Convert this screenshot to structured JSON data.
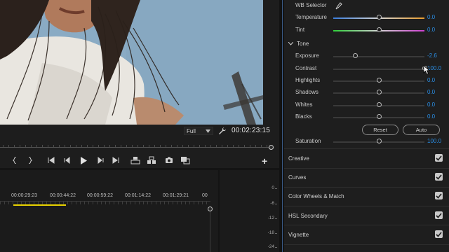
{
  "monitor": {
    "zoom": "Full",
    "timecode": "00:02:23:15"
  },
  "timeline": {
    "ruler": [
      "00:00:29:23",
      "00:00:44:22",
      "00:00:59:22",
      "00:01:14:22",
      "00:01:29:21",
      "00"
    ],
    "meter": [
      "0",
      "-6",
      "-12",
      "-18",
      "-24"
    ]
  },
  "lumetri": {
    "wb_selector": "WB Selector",
    "temperature": {
      "label": "Temperature",
      "value": "0.0",
      "level": 0.5
    },
    "tint": {
      "label": "Tint",
      "value": "0.0",
      "level": 0.5
    },
    "tone_label": "Tone",
    "tone": [
      {
        "label": "Exposure",
        "value": "-2.6",
        "level": 0.24
      },
      {
        "label": "Contrast",
        "value": "100.0",
        "level": 1.0
      },
      {
        "label": "Highlights",
        "value": "0.0",
        "level": 0.5
      },
      {
        "label": "Shadows",
        "value": "0.0",
        "level": 0.5
      },
      {
        "label": "Whites",
        "value": "0.0",
        "level": 0.5
      },
      {
        "label": "Blacks",
        "value": "0.0",
        "level": 0.5
      }
    ],
    "reset_label": "Reset",
    "auto_label": "Auto",
    "saturation": {
      "label": "Saturation",
      "value": "100.0",
      "level": 0.5
    },
    "sections": [
      "Creative",
      "Curves",
      "Color Wheels & Match",
      "HSL Secondary",
      "Vignette"
    ]
  },
  "colors": {
    "accent_value": "#2b8fe6",
    "workarea": "#e8d200"
  }
}
